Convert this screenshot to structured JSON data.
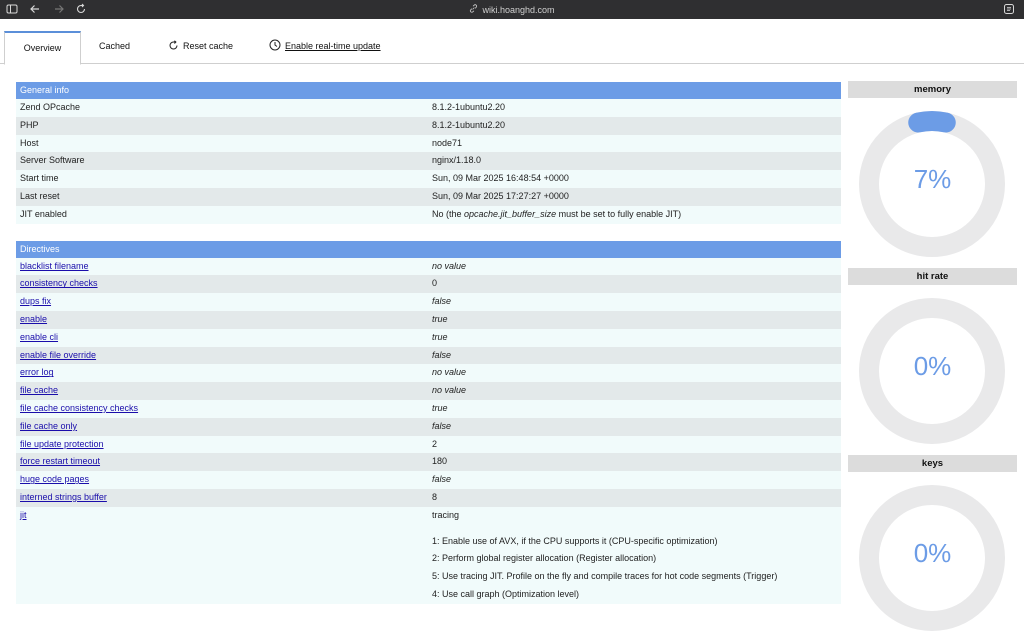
{
  "browser": {
    "url": "wiki.hoanghd.com"
  },
  "tabs": {
    "overview": "Overview",
    "cached": "Cached",
    "reset": "Reset cache",
    "realtime": "Enable real-time update"
  },
  "general": {
    "title": "General info",
    "rows": [
      {
        "k": "Zend OPcache",
        "v": "8.1.2-1ubuntu2.20"
      },
      {
        "k": "PHP",
        "v": "8.1.2-1ubuntu2.20"
      },
      {
        "k": "Host",
        "v": "node71"
      },
      {
        "k": "Server Software",
        "v": "nginx/1.18.0"
      },
      {
        "k": "Start time",
        "v": "Sun, 09 Mar 2025 16:48:54 +0000"
      },
      {
        "k": "Last reset",
        "v": "Sun, 09 Mar 2025 17:27:27 +0000"
      },
      {
        "k": "JIT enabled",
        "v_pre": "No (the ",
        "v_em": "opcache.jit_buffer_size",
        "v_post": " must be set to fully enable JIT)"
      }
    ]
  },
  "directives": {
    "title": "Directives",
    "rows": [
      {
        "k": "blacklist filename",
        "v": "no value"
      },
      {
        "k": "consistency checks",
        "v": "0"
      },
      {
        "k": "dups fix",
        "v": "false"
      },
      {
        "k": "enable",
        "v": "true"
      },
      {
        "k": "enable cli",
        "v": "true"
      },
      {
        "k": "enable file override",
        "v": "false"
      },
      {
        "k": "error log",
        "v": "no value"
      },
      {
        "k": "file cache",
        "v": "no value"
      },
      {
        "k": "file cache consistency checks",
        "v": "true"
      },
      {
        "k": "file cache only",
        "v": "false"
      },
      {
        "k": "file update protection",
        "v": "2"
      },
      {
        "k": "force restart timeout",
        "v": "180"
      },
      {
        "k": "huge code pages",
        "v": "false"
      },
      {
        "k": "interned strings buffer",
        "v": "8"
      },
      {
        "k": "jit",
        "v": "tracing"
      }
    ],
    "jit_details": [
      "1: Enable use of AVX, if the CPU supports it (CPU-specific optimization)",
      "2: Perform global register allocation (Register allocation)",
      "5: Use tracing JIT. Profile on the fly and compile traces for hot code segments (Trigger)",
      "4: Use call graph (Optimization level)"
    ]
  },
  "widgets": {
    "memory": {
      "title": "memory",
      "value": "7%",
      "fraction": 0.07
    },
    "hit_rate": {
      "title": "hit rate",
      "value": "0%",
      "fraction": 0
    },
    "keys": {
      "title": "keys",
      "value": "0%",
      "fraction": 0
    }
  },
  "colors": {
    "accent": "#6c9ce6",
    "ring": "#e9e9ea",
    "chrome": "#2f2f31"
  }
}
